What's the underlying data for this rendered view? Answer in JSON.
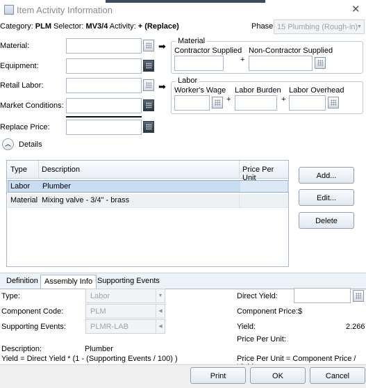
{
  "window": {
    "title": "Item Activity Information"
  },
  "header": {
    "category_label": "Category:",
    "category_value": "PLM",
    "selector_label": "Selector:",
    "selector_value": "MV3/4",
    "activity_label": "Activity:",
    "activity_value": "+ (Replace)",
    "phase_label": "Phase:",
    "phase_value": "15 Plumbing (Rough-in)"
  },
  "fields": {
    "material": "Material:",
    "equipment": "Equipment:",
    "retail_labor": "Retail Labor:",
    "market_conditions": "Market Conditions:",
    "replace_price": "Replace Price:"
  },
  "material_group": {
    "title": "Material",
    "contractor_supplied": "Contractor Supplied",
    "non_contractor_supplied": "Non-Contractor Supplied",
    "plus": "+"
  },
  "labor_group": {
    "title": "Labor",
    "workers_wage": "Worker's Wage",
    "labor_burden": "Labor Burden",
    "labor_overhead": "Labor Overhead",
    "plus": "+"
  },
  "details_label": "Details",
  "table": {
    "headers": [
      "Type",
      "Description",
      "Price Per Unit"
    ],
    "rows": [
      {
        "type": "Labor",
        "description": "Plumber",
        "price": ""
      },
      {
        "type": "Material",
        "description": "Mixing valve - 3/4\" - brass",
        "price": ""
      }
    ]
  },
  "side_buttons": {
    "add": "Add...",
    "edit": "Edit...",
    "delete": "Delete"
  },
  "tabs": {
    "definition": "Definition",
    "assembly_info": "Assembly Info",
    "supporting_events": "Supporting Events"
  },
  "assembly": {
    "type_label": "Type:",
    "type_value": "Labor",
    "component_code_label": "Component Code:",
    "component_code_value": "PLM",
    "supporting_events_label": "Supporting Events:",
    "supporting_events_value": "PLMR-LAB",
    "description_label": "Description:",
    "description_value": "Plumber",
    "formula_left": "Yield = Direct Yield * (1 - (Supporting Events / 100) )",
    "direct_yield_label": "Direct Yield:",
    "component_price_label": "Component Price:$",
    "yield_label": "Yield:",
    "yield_value": "2.266",
    "price_per_unit_label": "Price Per Unit:",
    "formula_right": "Price Per Unit = Component Price / Yield"
  },
  "footer_buttons": {
    "print": "Print",
    "ok": "OK",
    "cancel": "Cancel"
  }
}
